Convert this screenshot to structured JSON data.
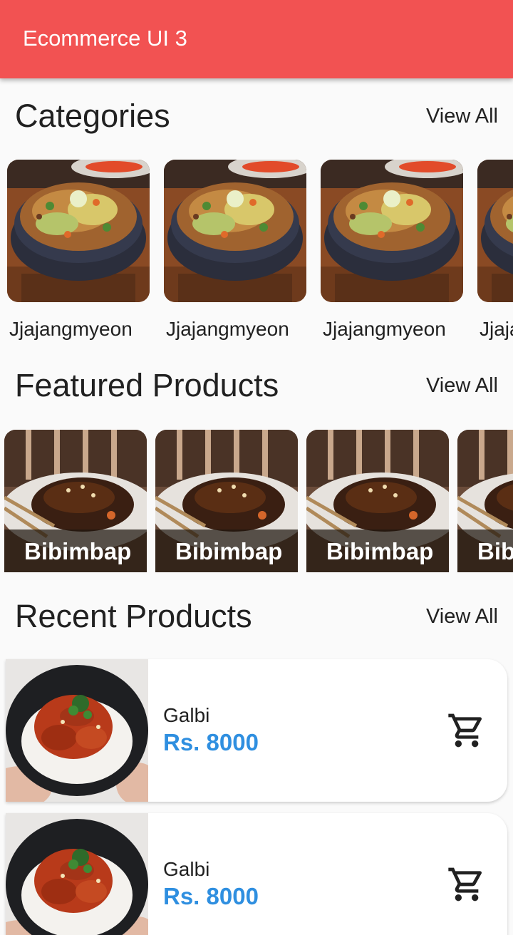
{
  "appbar": {
    "title": "Ecommerce UI 3"
  },
  "categories": {
    "title": "Categories",
    "view_all": "View All",
    "items": [
      {
        "label": "Jjajangmyeon"
      },
      {
        "label": "Jjajangmyeon"
      },
      {
        "label": "Jjajangmyeon"
      },
      {
        "label": "Jjajangmyeon"
      }
    ]
  },
  "featured": {
    "title": "Featured Products",
    "view_all": "View All",
    "items": [
      {
        "label": "Bibimbap"
      },
      {
        "label": "Bibimbap"
      },
      {
        "label": "Bibimbap"
      },
      {
        "label": "Bibimbap"
      }
    ]
  },
  "recent": {
    "title": "Recent Products",
    "view_all": "View All",
    "items": [
      {
        "name": "Galbi",
        "price": "Rs. 8000",
        "icon": "cart-icon"
      },
      {
        "name": "Galbi",
        "price": "Rs. 8000",
        "icon": "cart-icon"
      }
    ]
  },
  "colors": {
    "appbar": "#f25252",
    "price": "#2f8fe0"
  }
}
